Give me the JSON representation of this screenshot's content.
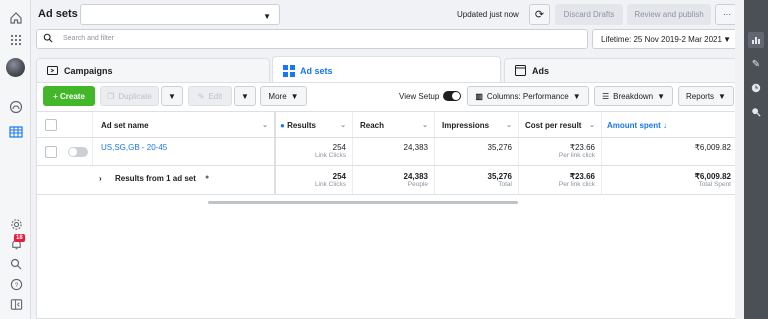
{
  "header": {
    "title": "Ad sets",
    "updated": "Updated just now",
    "discard_label": "Discard Drafts",
    "review_label": "Review and publish",
    "more_dots": "···"
  },
  "search": {
    "placeholder": "Search and filter"
  },
  "date_range": "Lifetime: 25 Nov 2019-2 Mar 2021",
  "tabs": [
    {
      "label": "Campaigns",
      "icon": "folder-icon"
    },
    {
      "label": "Ad sets",
      "icon": "grid-icon"
    },
    {
      "label": "Ads",
      "icon": "ad-icon"
    }
  ],
  "toolbar": {
    "create_label": "+ Create",
    "duplicate_label": "Duplicate",
    "edit_label": "Edit",
    "more_label": "More",
    "view_setup_label": "View Setup",
    "columns_label": "Columns: Performance",
    "breakdown_label": "Breakdown",
    "reports_label": "Reports"
  },
  "table": {
    "headers": {
      "name": "Ad set name",
      "results": "Results",
      "reach": "Reach",
      "impressions": "Impressions",
      "cpr": "Cost per result",
      "spent": "Amount spent"
    },
    "row": {
      "name": "US,SG,GB - 20-45",
      "results": "254",
      "results_sub": "Link Clicks",
      "reach": "24,383",
      "impressions": "35,276",
      "cpr": "₹23.66",
      "cpr_sub": "Per link click",
      "spent": "₹6,009.82"
    },
    "summary": {
      "label": "Results from 1 ad set",
      "results": "254",
      "results_sub": "Link Clicks",
      "reach": "24,383",
      "reach_sub": "People",
      "impressions": "35,276",
      "impressions_sub": "Total",
      "cpr": "₹23.66",
      "cpr_sub": "Per link click",
      "spent": "₹6,009.82",
      "spent_sub": "Total Spent"
    }
  },
  "notification_count": "18",
  "colors": {
    "accent": "#1877f2",
    "create": "#42b72a",
    "badge": "#e41e3f"
  }
}
